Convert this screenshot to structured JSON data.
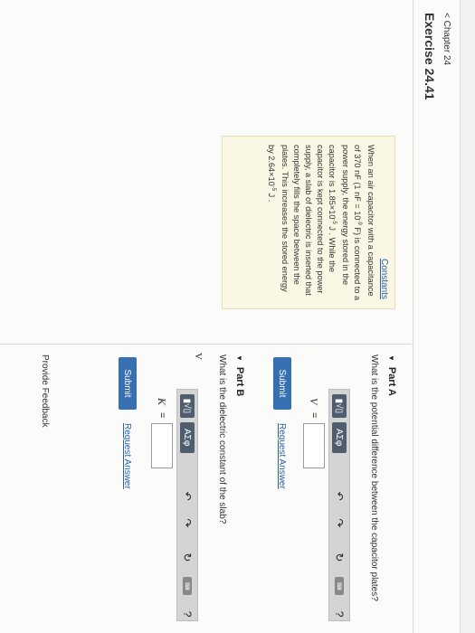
{
  "header": {
    "chapter": "< Chapter 24",
    "exercise": "Exercise 24.41"
  },
  "problem": {
    "constants_link": "Constants",
    "text_1": "When an air capacitor with a capacitance of 370 nF (1 nF = 10",
    "exp_1": "-9",
    "text_2": " F) is connected to a power supply, the energy stored in the capacitor is 1.85×10",
    "exp_2": "-5",
    "text_3": " J . While the capacitor is kept connected to the power supply, a slab of dielectric is inserted that completely fills the space between the plates. This increases the stored energy by 2.64×10",
    "exp_3": "-5",
    "text_4": " J ."
  },
  "part_a": {
    "title": "Part A",
    "question": "What is the potential difference between the capacitor plates?",
    "variable": "V",
    "equals": "=",
    "unit": "V",
    "submit": "Submit",
    "request": "Request Answer"
  },
  "part_b": {
    "title": "Part B",
    "question": "What is the dielectric constant of the slab?",
    "variable": "K",
    "equals": "=",
    "submit": "Submit",
    "request": "Request Answer"
  },
  "toolbar": {
    "template": "▮√▯",
    "greek": "ΑΣφ",
    "undo": "↶",
    "redo": "↷",
    "reset": "↻",
    "keyboard": "⌨",
    "help": "?"
  },
  "footer": {
    "feedback": "Provide Feedback"
  },
  "colors": {
    "link": "#2a62a8",
    "submit": "#376fb3",
    "info_bg": "#faf7e4"
  }
}
